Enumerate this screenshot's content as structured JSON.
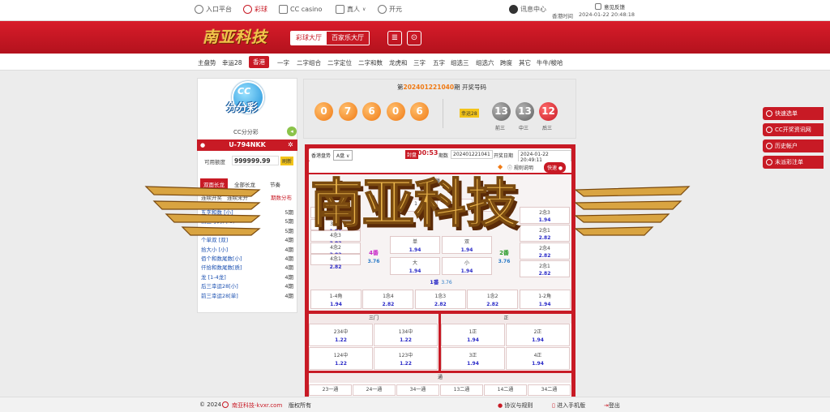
{
  "topbar": {
    "links": [
      {
        "label": "入口平台",
        "icon": "house-icon"
      },
      {
        "label": "彩球",
        "icon": "lottery-icon"
      },
      {
        "label": "CC casino",
        "icon": "casino-icon"
      },
      {
        "label": "真人",
        "icon": "live-icon",
        "suffix": "∨"
      },
      {
        "label": "开元",
        "icon": "kaiyuan-icon"
      }
    ],
    "msg_center": "讯息中心",
    "feedback": "意见反馈",
    "server_time_label": "香港时间",
    "server_time": "2024-01-22 20:48:18"
  },
  "brand": {
    "logo_text": "南亚科技",
    "hall_a": "彩球大厅",
    "hall_b": "百家乐大厅"
  },
  "nav": {
    "items": [
      "主盘势",
      "幸运28",
      "香港",
      "一字",
      "二字组合",
      "二字定位",
      "二字和数",
      "龙虎和",
      "三字",
      "五字",
      "组选三",
      "组选六",
      "跨度",
      "其它",
      "牛牛/梭哈"
    ],
    "active_index": 2
  },
  "left": {
    "game_name": "CC分分彩",
    "logo_text": "分分彩",
    "user_id": "U-794NKK",
    "credit_label": "可用额度",
    "credit_value": "999999.99",
    "refresh_label": "刷新",
    "tabs": [
      "双面长龙",
      "全部长龙",
      "节奏"
    ],
    "list_header": [
      "连续开奖",
      "连续未开"
    ],
    "list_header_right": "期数分布",
    "rows": [
      {
        "label": "五字和数 [小]",
        "value": "5期"
      },
      {
        "label": "前三号码(牛8)",
        "value": "5期"
      },
      {
        "label": "后三号码(牛8) [大]",
        "value": "5期"
      },
      {
        "label": "个单双 [双]",
        "value": "4期"
      },
      {
        "label": "拾大小 [小]",
        "value": "4期"
      },
      {
        "label": "佰个和数尾数[小]",
        "value": "4期"
      },
      {
        "label": "仟拾和数尾数[质]",
        "value": "4期"
      },
      {
        "label": "龙 [1-4龙]",
        "value": "4期"
      },
      {
        "label": "后三幸运28[小]",
        "value": "4期"
      },
      {
        "label": "前三幸运28[单]",
        "value": "4期"
      }
    ]
  },
  "draw": {
    "period_prefix": "第",
    "period": "202401221040",
    "period_suffix": "期 开奖号码",
    "balls": [
      "0",
      "7",
      "6",
      "0",
      "6"
    ],
    "lucky_label": "幸运28",
    "sums": [
      {
        "v": "13",
        "l": "前三"
      },
      {
        "v": "13",
        "l": "中三"
      },
      {
        "v": "12",
        "l": "后三"
      }
    ],
    "colors": {
      "orange": "#f07a14",
      "gray": "#5e5e5e",
      "red": "#c81a25"
    }
  },
  "bet": {
    "mode_label": "香港盘势",
    "mode_value": "A盘",
    "countdown_label": "封盘",
    "countdown": "00:53",
    "period_label": "期数",
    "period": "202401221041",
    "open_label": "开奖日期",
    "open_date": "2024-01-22 20:49:11",
    "rules_label": "规则说明",
    "quick_label": "快速",
    "fan_title": "番摊",
    "fan_cells": [
      {
        "t": "3念4",
        "o": "1.94"
      },
      {
        "t": "3念1",
        "o": "1.94"
      },
      {
        "t": "4念3",
        "o": "2.82"
      },
      {
        "t": "4念2",
        "o": "2.82"
      },
      {
        "t": "4念1",
        "o": "2.82"
      },
      {
        "t": "2念3",
        "o": "1.94"
      },
      {
        "t": "2念1",
        "o": "2.82"
      },
      {
        "t": "2念4",
        "o": "2.82"
      },
      {
        "t": "2念1",
        "o": "2.82"
      }
    ],
    "fan4": {
      "t": "4番",
      "o": "3.76"
    },
    "fan2": {
      "t": "2番",
      "o": "3.76"
    },
    "fan1": {
      "t": "1番",
      "o": "3.76"
    },
    "dan": {
      "t": "单",
      "o": "1.94"
    },
    "shuang": {
      "t": "双",
      "o": "1.94"
    },
    "da": {
      "t": "大",
      "o": "1.94"
    },
    "xiao": {
      "t": "小",
      "o": "1.94"
    },
    "top_mid": [
      {
        "t": "1",
        "o": ""
      },
      {
        "t": "单",
        "o": "3.76"
      },
      {
        "t": "3",
        "o": ""
      }
    ],
    "bottom_row": [
      {
        "t": "1-4角",
        "o": "1.94"
      },
      {
        "t": "1念4",
        "o": "2.82"
      },
      {
        "t": "1念3",
        "o": "2.82"
      },
      {
        "t": "1念2",
        "o": "2.82"
      },
      {
        "t": "1-2角",
        "o": "1.94"
      }
    ],
    "sanmen_title": "三门",
    "sanmen": [
      {
        "t": "234中",
        "o": "1.22"
      },
      {
        "t": "134中",
        "o": "1.22"
      },
      {
        "t": "124中",
        "o": "1.22"
      },
      {
        "t": "123中",
        "o": "1.22"
      }
    ],
    "zheng_title": "正",
    "zheng": [
      {
        "t": "1正",
        "o": "1.94"
      },
      {
        "t": "2正",
        "o": "1.94"
      },
      {
        "t": "3正",
        "o": "1.94"
      },
      {
        "t": "4正",
        "o": "1.94"
      }
    ],
    "tong_title": "通",
    "tong": [
      "23一通",
      "24一通",
      "34一通",
      "13二通",
      "14二通",
      "34二通"
    ]
  },
  "side": [
    "快速选单",
    "CC开奖资讯网",
    "历史帐户",
    "未派彩注单"
  ],
  "footer": {
    "copyright": "© 2024",
    "site": "南亚科技-kvxr.com",
    "rights": "版权所有",
    "terms": "协议与规则",
    "mobile": "进入手机版",
    "logout": "登出"
  },
  "watermark": "南亚科技"
}
